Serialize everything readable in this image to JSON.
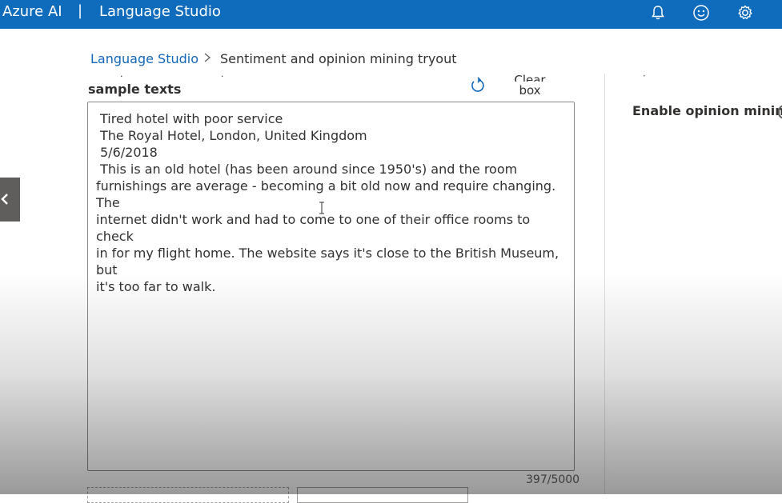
{
  "header": {
    "brand": "Azure AI",
    "separator": "|",
    "product": "Language Studio",
    "icons": [
      "bell-icon",
      "smiley-icon",
      "gear-icon"
    ]
  },
  "breadcrumb": {
    "root": "Language Studio",
    "current": "Sentiment and opinion mining tryout"
  },
  "input": {
    "label": "sample texts",
    "clear_button": [
      "Clear text",
      "box"
    ],
    "lines": [
      "Tired hotel with poor service",
      "The Royal Hotel, London, United Kingdom",
      "5/6/2018",
      " This is an old hotel (has been around since 1950's) and the room",
      "furnishings are average - becoming a bit old now and require changing. The",
      "internet didn't work and had to come to one of their office rooms to check",
      "in for my flight home. The website says it's close to the British Museum, but",
      "it's too far to walk."
    ],
    "char_count": "397/5000"
  },
  "settings": {
    "opinion_mining_label": "Enable opinion mining"
  },
  "colors": {
    "header_bg": "#0f6cbd",
    "link": "#1366b8"
  }
}
